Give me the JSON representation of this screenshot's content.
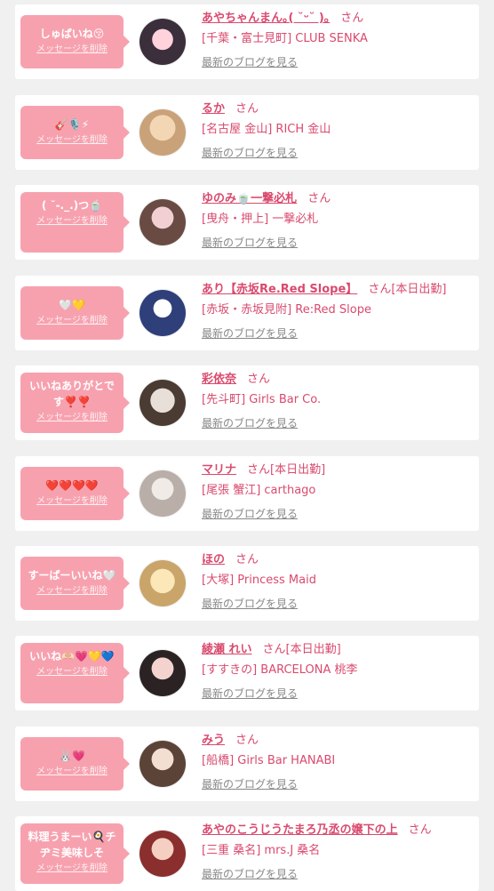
{
  "delete_label": "メッセージを削除",
  "blog_label": "最新のブログを見る",
  "colors": {
    "accent": "#d94a6e",
    "bubble": "#f7a1af"
  },
  "entries": [
    {
      "message": "しゅぱいね😚",
      "name": "あやちゃんまん｡( ˘ᵕ˘ )｡",
      "suffix": "さん",
      "shop": "[千葉・富士見町] CLUB SENKA",
      "avatar": "avatar-photo"
    },
    {
      "message": "🎸🎙️⚡",
      "name": "るか",
      "suffix": "さん",
      "shop": "[名古屋 金山] RICH 金山",
      "avatar": "avatar-photo"
    },
    {
      "message": "( ˘-._.)つ🍵",
      "name": "ゆのみ🍵一撃必札",
      "suffix": "さん",
      "shop": "[曳舟・押上] 一撃必札",
      "avatar": "avatar-photo"
    },
    {
      "message": "🤍💛",
      "name": "あり【赤坂Re.Red Slope】",
      "suffix": "さん[本日出勤]",
      "shop": "[赤坂・赤坂見附] Re:Red Slope",
      "avatar": "avatar-photo"
    },
    {
      "message": "いいねありがとです❣️❣️",
      "name": "彩依奈",
      "suffix": "さん",
      "shop": "[先斗町] Girls Bar Co.",
      "avatar": "avatar-photo"
    },
    {
      "message": "❤️❤️❤️❤️",
      "name": "マリナ",
      "suffix": "さん[本日出勤]",
      "shop": "[尾張 蟹江] carthago",
      "avatar": "avatar-photo"
    },
    {
      "message": "すーぱーいいね🤍",
      "name": "ほの",
      "suffix": "さん",
      "shop": "[大塚] Princess Maid",
      "avatar": "avatar-photo"
    },
    {
      "message": "いいね🫶🏻💗💛💙",
      "name": "綾瀬 れい",
      "suffix": "さん[本日出勤]",
      "shop": "[すすきの] BARCELONA 桃李",
      "avatar": "avatar-photo"
    },
    {
      "message": "🐰💗",
      "name": "みう",
      "suffix": "さん",
      "shop": "[船橋] Girls Bar HANABI",
      "avatar": "avatar-photo"
    },
    {
      "message": "料理うまーい🍳チヂミ美味しそ",
      "name": "あやのこうじうたまろ乃丞の嬢下の上",
      "suffix": "さん",
      "shop": "[三重 桑名] mrs.J 桑名",
      "avatar": "avatar-photo"
    }
  ]
}
